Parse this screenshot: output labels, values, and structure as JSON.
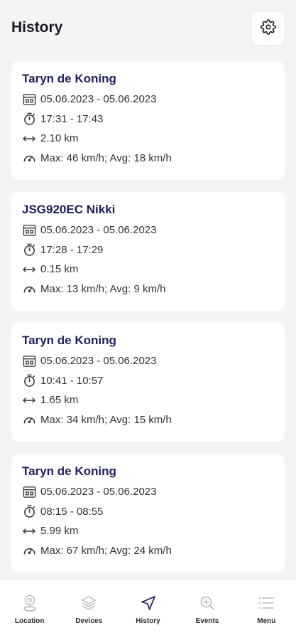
{
  "header": {
    "title": "History",
    "settings_icon": "gear-icon"
  },
  "trips": [
    {
      "name": "Taryn de Koning",
      "date": "05.06.2023 - 05.06.2023",
      "time": "17:31 - 17:43",
      "distance": "2.10 km",
      "speed": "Max: 46 km/h; Avg: 18 km/h"
    },
    {
      "name": "JSG920EC Nikki",
      "date": "05.06.2023 - 05.06.2023",
      "time": "17:28 - 17:29",
      "distance": "0.15 km",
      "speed": "Max: 13 km/h; Avg: 9 km/h"
    },
    {
      "name": "Taryn de Koning",
      "date": "05.06.2023 - 05.06.2023",
      "time": "10:41 - 10:57",
      "distance": "1.65 km",
      "speed": "Max: 34 km/h; Avg: 15 km/h"
    },
    {
      "name": "Taryn de Koning",
      "date": "05.06.2023 - 05.06.2023",
      "time": "08:15 - 08:55",
      "distance": "5.99 km",
      "speed": "Max: 67 km/h; Avg: 24 km/h"
    }
  ],
  "nav": {
    "items": [
      {
        "label": "Location",
        "icon": "location-pin-icon",
        "active": false
      },
      {
        "label": "Devices",
        "icon": "layers-icon",
        "active": false
      },
      {
        "label": "History",
        "icon": "navigation-arrow-icon",
        "active": true
      },
      {
        "label": "Events",
        "icon": "zoom-plus-icon",
        "active": false
      },
      {
        "label": "Menu",
        "icon": "menu-list-icon",
        "active": false
      }
    ]
  },
  "colors": {
    "title": "#1d1f5c",
    "background": "#f4f4f6",
    "card": "#ffffff",
    "inactive_icon": "#b8b8c2"
  }
}
